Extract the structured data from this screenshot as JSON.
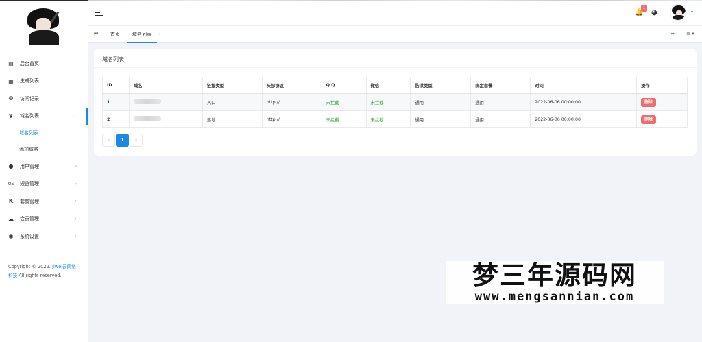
{
  "sidebar": {
    "logo_icon": "ninja-avatar-logo",
    "items": [
      {
        "label": "后台首页",
        "icon": "dashboard-icon",
        "glyph": "▤"
      },
      {
        "label": "生成列表",
        "icon": "table-icon",
        "glyph": "▦"
      },
      {
        "label": "访问记录",
        "icon": "puzzle-icon",
        "glyph": "✣"
      },
      {
        "label": "域名列表",
        "icon": "leaf-icon",
        "glyph": "❦",
        "arrow": "⌄"
      },
      {
        "label": "用户管理",
        "icon": "user-circle-icon",
        "glyph": "●",
        "arrow": "›"
      },
      {
        "label": "短链管理",
        "icon": "link-os-icon",
        "glyph": "OS",
        "arrow": "›"
      },
      {
        "label": "套餐管理",
        "icon": "kickstarter-icon",
        "glyph": "K",
        "arrow": "›"
      },
      {
        "label": "会员管理",
        "icon": "cloud-icon",
        "glyph": "☁",
        "arrow": "›"
      },
      {
        "label": "系统设置",
        "icon": "globe-icon",
        "glyph": "◉",
        "arrow": "›"
      }
    ],
    "subitems": [
      {
        "label": "域名列表"
      },
      {
        "label": "添加域名"
      }
    ],
    "copyright_prefix": "Copyright © 2022.",
    "copyright_link": "Jiwei云网络科技",
    "copyright_suffix": "All rights reserved."
  },
  "header": {
    "menu_icon": "hamburger-icon",
    "notification_badge": "1",
    "bell_glyph": "🔔",
    "palette_glyph": "◕",
    "caret_glyph": "▾"
  },
  "tabs": {
    "prev_glyph": "⏮",
    "next_glyph": "⏭",
    "menu_glyph": "≡ ▾",
    "close_glyph": "›",
    "items": [
      {
        "label": "首页"
      },
      {
        "label": "域名列表"
      }
    ]
  },
  "card": {
    "title": "域名列表"
  },
  "table": {
    "headers": [
      "ID",
      "域名",
      "链接类型",
      "头部协议",
      "Q Q",
      "微信",
      "防洪类型",
      "绑定套餐",
      "时间",
      "操作"
    ],
    "rows": [
      {
        "id": "1",
        "type": "入口",
        "protocol": "http://",
        "qq": "未拦截",
        "wechat": "未拦截",
        "flood": "通用",
        "plan": "通用",
        "time": "2022-06-06 00:00:00",
        "action": "删除"
      },
      {
        "id": "2",
        "type": "落地",
        "protocol": "http://",
        "qq": "未拦截",
        "wechat": "未拦截",
        "flood": "通用",
        "plan": "通用",
        "time": "2022-06-06 00:00:00",
        "action": "删除"
      }
    ]
  },
  "pager": {
    "prev": "«",
    "current": "1",
    "next": "»"
  },
  "watermark": {
    "cn": "梦三年源码网",
    "en": "www.mengsannian.com"
  },
  "colors": {
    "accent": "#1e88e5",
    "danger": "#f56c6c",
    "success": "#2e9c2e"
  }
}
